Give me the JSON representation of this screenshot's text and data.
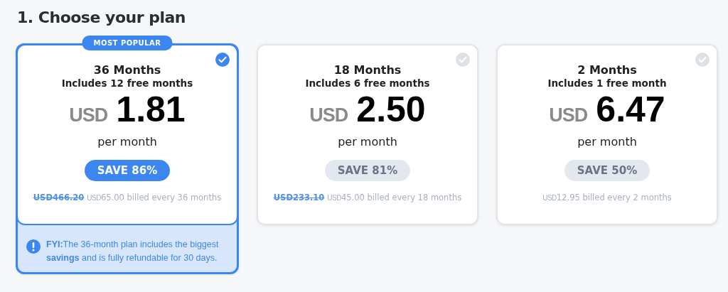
{
  "heading": "1. Choose your plan",
  "plans": [
    {
      "badge": "MOST POPULAR",
      "selected": true,
      "title": "36 Months",
      "subtitle": "Includes 12 free months",
      "currency": "USD",
      "price": "1.81",
      "period": "per month",
      "save": "SAVE 86%",
      "old_price": "USD466.20",
      "billed_currency": "USD",
      "billed": "65.00 billed every 36 months",
      "note": "**FYI:**The 36-month plan includes the biggest **savings** and is fully refundable for 30 days."
    },
    {
      "selected": false,
      "title": "18 Months",
      "subtitle": "Includes 6 free months",
      "currency": "USD",
      "price": "2.50",
      "period": "per month",
      "save": "SAVE 81%",
      "old_price": "USD233.10",
      "billed_currency": "USD",
      "billed": "45.00 billed every 18 months"
    },
    {
      "selected": false,
      "title": "2 Months",
      "subtitle": "Includes 1 free month",
      "currency": "USD",
      "price": "6.47",
      "period": "per month",
      "save": "SAVE 50%",
      "billed_currency": "USD",
      "billed": "12.95 billed every 2 months"
    }
  ]
}
